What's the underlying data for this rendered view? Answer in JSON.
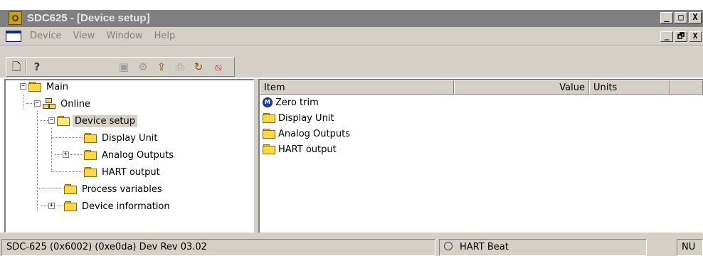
{
  "window": {
    "title": "SDC625 - [Device setup]",
    "controls": [
      "_",
      "□",
      "X"
    ]
  },
  "menubar": {
    "items": [
      "Device",
      "View",
      "Window",
      "Help"
    ],
    "mdi_controls": [
      "_",
      "🗗",
      "X"
    ]
  },
  "toolbar": {
    "buttons": [
      {
        "icon": "new-document-icon",
        "glyph": "🗋",
        "enabled": true
      },
      {
        "icon": "help-icon",
        "glyph": "?",
        "enabled": true
      },
      {
        "icon": "device-properties-icon",
        "glyph": "▣",
        "enabled": false
      },
      {
        "icon": "device-network-icon",
        "glyph": "⚙",
        "enabled": false
      },
      {
        "icon": "upload-icon",
        "glyph": "⇪",
        "enabled": true
      },
      {
        "icon": "print-icon",
        "glyph": "⎙",
        "enabled": false
      },
      {
        "icon": "refresh-icon",
        "glyph": "↻",
        "enabled": true
      },
      {
        "icon": "stop-icon",
        "glyph": "⦸",
        "enabled": true
      }
    ]
  },
  "tree": {
    "nodes": [
      {
        "label": "Main",
        "level": 0,
        "expander": "−",
        "icon": "folder"
      },
      {
        "label": "Online",
        "level": 1,
        "expander": "−",
        "icon": "network"
      },
      {
        "label": "Device setup",
        "level": 2,
        "expander": "−",
        "icon": "folder-open",
        "selected": true
      },
      {
        "label": "Display Unit",
        "level": 3,
        "expander": "",
        "icon": "folder"
      },
      {
        "label": "Analog Outputs",
        "level": 3,
        "expander": "+",
        "icon": "folder"
      },
      {
        "label": "HART output",
        "level": 3,
        "expander": "",
        "icon": "folder"
      },
      {
        "label": "Process variables",
        "level": 2,
        "expander": "",
        "icon": "folder"
      },
      {
        "label": "Device information",
        "level": 2,
        "expander": "+",
        "icon": "folder"
      }
    ]
  },
  "list": {
    "columns": [
      "Item",
      "Value",
      "Units",
      ""
    ],
    "rows": [
      {
        "label": "Zero trim",
        "icon": "method"
      },
      {
        "label": "Display Unit",
        "icon": "folder"
      },
      {
        "label": "Analog Outputs",
        "icon": "folder"
      },
      {
        "label": "HART output",
        "icon": "folder"
      }
    ]
  },
  "statusbar": {
    "device_info": "SDC-625   (0x6002)  (0xe0da) Dev Rev 03.02",
    "hart_beat": "HART Beat",
    "mode": "NU"
  }
}
